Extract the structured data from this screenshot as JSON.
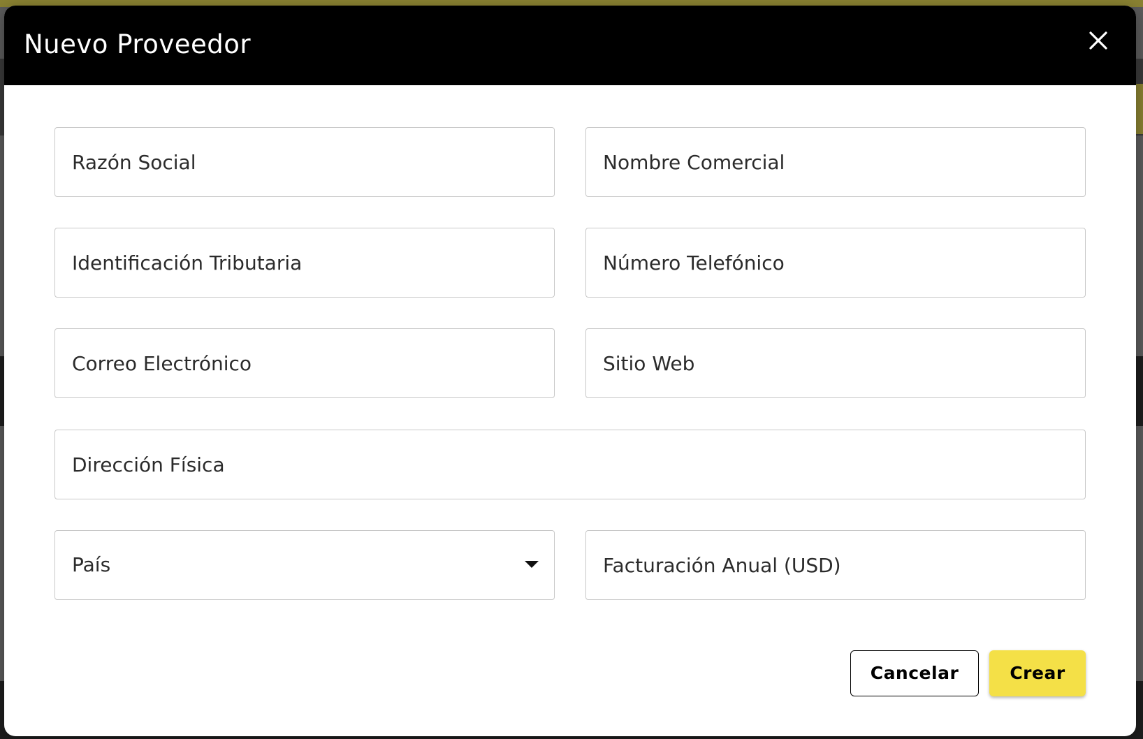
{
  "modal": {
    "title": "Nuevo Proveedor",
    "close_icon": "close-icon"
  },
  "form": {
    "razon_social": {
      "placeholder": "Razón Social",
      "value": ""
    },
    "nombre_comercial": {
      "placeholder": "Nombre Comercial",
      "value": ""
    },
    "identificacion_tributaria": {
      "placeholder": "Identificación Tributaria",
      "value": ""
    },
    "numero_telefonico": {
      "placeholder": "Número Telefónico",
      "value": ""
    },
    "correo_electronico": {
      "placeholder": "Correo Electrónico",
      "value": ""
    },
    "sitio_web": {
      "placeholder": "Sitio Web",
      "value": ""
    },
    "direccion_fisica": {
      "placeholder": "Dirección Física",
      "value": ""
    },
    "pais": {
      "label": "País",
      "icon": "chevron-down-icon"
    },
    "facturacion_anual": {
      "placeholder": "Facturación Anual (USD)",
      "value": ""
    }
  },
  "actions": {
    "cancel_label": "Cancelar",
    "create_label": "Crear"
  },
  "colors": {
    "header_bg": "#000000",
    "accent": "#f4e047",
    "field_border": "#c8c8c8"
  }
}
